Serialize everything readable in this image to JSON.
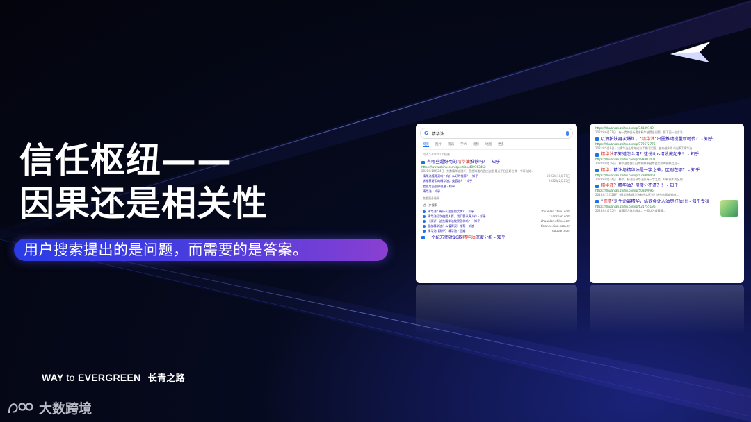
{
  "title": {
    "line1": "信任枢纽——",
    "line2": "因果还是相关性"
  },
  "subtitle": "用户搜索提出的是问题，而需要的是答案。",
  "footer": {
    "brand_bold1": "WAY",
    "brand_light": "to",
    "brand_bold2": "EVERGREEN",
    "brand_cn": "长青之路"
  },
  "watermark": {
    "text": "大数跨境"
  },
  "colors": {
    "background": "#050818",
    "subtitle_gradient_start": "#2a3be6",
    "subtitle_gradient_end": "#8a3fd2",
    "link": "#1a0dab",
    "highlight": "#d93025"
  },
  "icons": [
    "paper-plane-logo-icon",
    "search-mic-icon",
    "site-favicon-icon"
  ],
  "search_left": {
    "query": "精华油",
    "tabs": [
      "网页",
      "图片",
      "资讯",
      "学术",
      "视频",
      "地图",
      "更多"
    ],
    "result_count": "约 4,530,000 个结果",
    "results": [
      {
        "title_pre": "有哪些超好用的",
        "title_hl": "精华油",
        "title_post": "推荐吗？ - 知乎",
        "url": "https://www.zhihu.com/question/489763452",
        "snippet": "2021年10月24日 · 为数精华油测评，您想知道的答应这里 最近平台正好在做一个叫有关..."
      }
    ],
    "mini_links": [
      {
        "text": "精华油值得买吗？有什么好的推荐？ - 知乎",
        "date": "2022年10月17日"
      },
      {
        "text": "求推荐好用的精华油，美容油？ - 知乎",
        "date": "2022年2月25日"
      },
      {
        "text": "脸部用面部护理油 - 知乎",
        "date": ""
      },
      {
        "text": "精华油 - 知乎",
        "date": ""
      }
    ],
    "more_results": "查看更多结果",
    "related_header": "进一步搜索",
    "related": [
      {
        "text": "精华油？有什么超值的大牌？ - 知乎",
        "domain": "zhuanlan.zhihu.com"
      },
      {
        "text": "精华油初次使用人群，我们要认真人体 - 知乎",
        "domain": "t.panshan.com"
      },
      {
        "text": "【测评】这些精华油效果怎样吗？ - 知乎",
        "domain": "zhuanlan.zhihu.com"
      },
      {
        "text": "面部精华油什么值得买？推荐 - 新浪",
        "domain": "finance.sina.com.cn"
      },
      {
        "text": "精华油【测评】精华油 - 豆瓣",
        "domain": "douban.com"
      }
    ],
    "bottom_result": {
      "title_pre": "一个配方师对16款",
      "title_hl": "精华油",
      "title_post": "深度分析 - 知乎"
    }
  },
  "search_right": {
    "top_url": "https://zhuanlan.zhihu.com/p/34189749",
    "top_snippet": "2022年6月21日 · 有一类的分析要求精华油提出问题，那下面一些方法 ...",
    "results": [
      {
        "title_pre": "以油护肤再次爆红，“",
        "title_hl": "精华油",
        "title_post": "”出圈推动投量新时代？ - 知乎",
        "url": "https://zhuanlan.zhihu.com/p/370672776",
        "snippet": "2021年5月8日 · 以精华油让今年成为了热门话题，越来越多的人选择了精华油..."
      },
      {
        "title_pre": "",
        "title_hl": "精华油",
        "title_post": "不知道怎么用？这份tips请收藏起来！ - 知乎",
        "url": "https://zhuanlan.zhihu.com/p/193802007",
        "snippet": "2020年8月18日 · 精华油是我们日常护肤中经常会用到的护肤品之一..."
      },
      {
        "title_pre": "",
        "title_hl": "精华",
        "title_post": "、精油与精华油是一字之差，区别在哪？ - 知乎",
        "url": "https://zhuanlan.zhihu.com/p/179880051",
        "snippet": "2020年8月14日 · 精华、精油与精华油只有一字之差，却有很大的区别..."
      },
      {
        "title_pre": "",
        "title_hl": "精华液",
        "title_post": "？精华油？傻傻分不清？！ - 知乎",
        "url": "https://zhuanlan.zhihu.com/p/50849095",
        "snippet": "2018年11月28日 · 精华液和精华油有什么区别？这些你都知道吗..."
      },
      {
        "title_pre": "“",
        "title_hl": "肾精",
        "title_post": "”是生命最精华，纵欲会让人油尽灯枯!!! - 知乎专栏",
        "url": "https://zhuanlan.zhihu.com/p/621755196",
        "snippet": "2023年4月15日 · 肾精是人体的根本，中医认为肾藏精..."
      }
    ]
  }
}
